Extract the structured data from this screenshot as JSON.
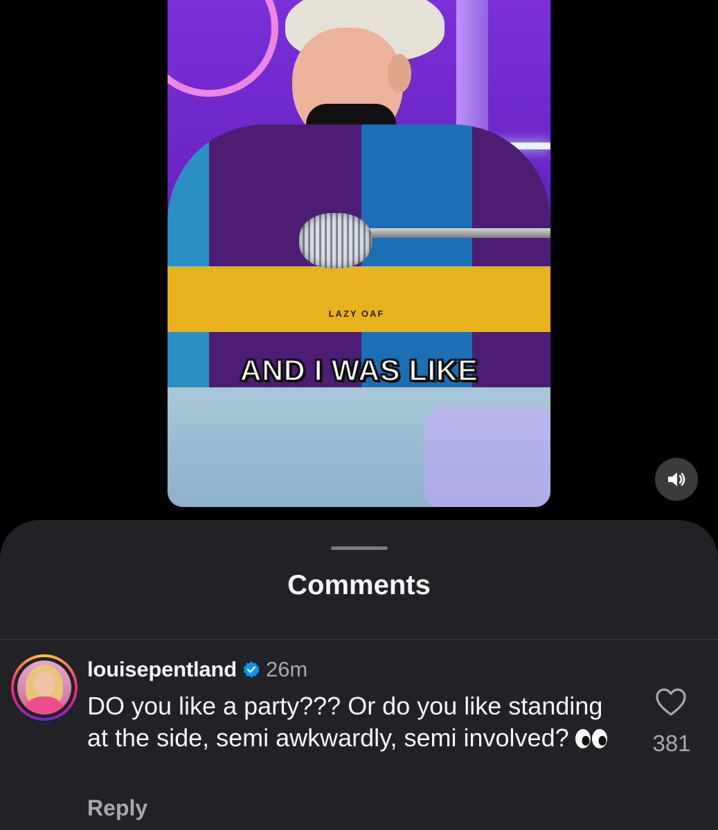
{
  "video": {
    "caption": "AND I WAS LIKE",
    "sweater_logo": "LAZY OAF"
  },
  "controls": {
    "mute_icon": "speaker-icon"
  },
  "comments": {
    "title": "Comments",
    "items": [
      {
        "username": "louisepentland",
        "verified": true,
        "time": "26m",
        "text": "DO you like a party??? Or do you like standing at the side, semi awkwardly, semi involved?",
        "emoji": "eyes-emoji",
        "reply_label": "Reply",
        "like_count": "381"
      }
    ]
  },
  "colors": {
    "sheet_bg": "#212226",
    "muted_text": "#a8a8ad",
    "verified_blue": "#0095f6"
  }
}
